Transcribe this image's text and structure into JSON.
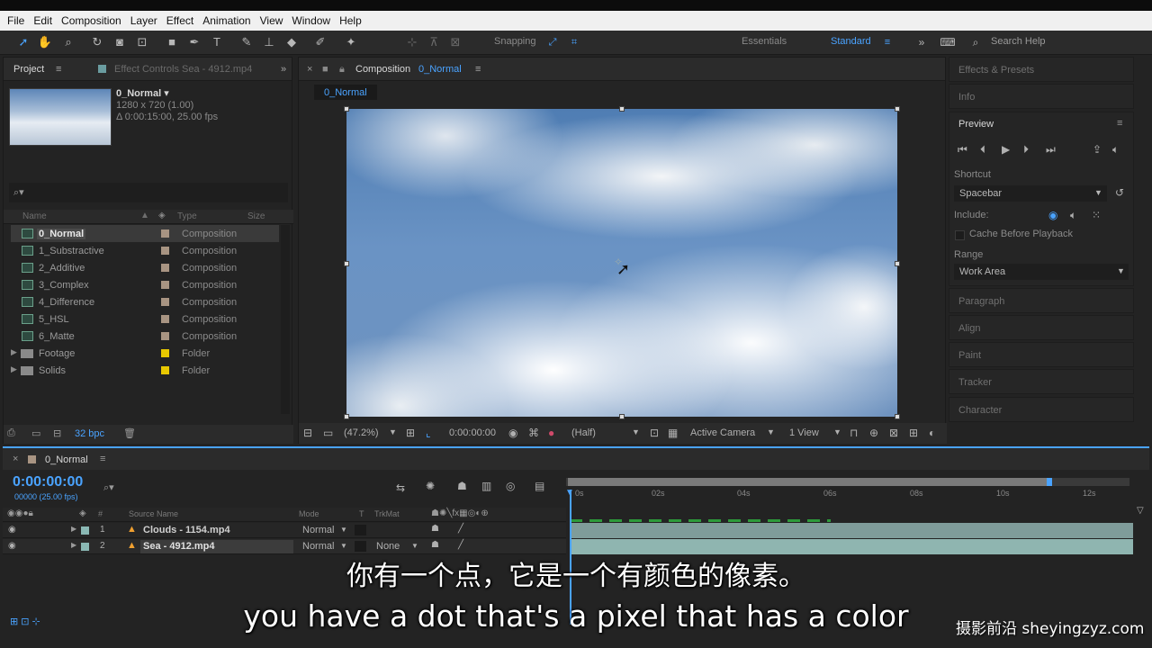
{
  "menu": [
    "File",
    "Edit",
    "Composition",
    "Layer",
    "Effect",
    "Animation",
    "View",
    "Window",
    "Help"
  ],
  "toolbar": {
    "snapping": "Snapping",
    "essentials": "Essentials",
    "standard": "Standard",
    "search_help": "Search Help"
  },
  "project": {
    "tab_project": "Project",
    "tab_effect_controls": "Effect Controls Sea - 4912.mp4",
    "comp_name": "0_Normal ▾",
    "comp_res": "1280 x 720 (1.00)",
    "comp_dur": "Δ 0:00:15:00, 25.00 fps",
    "col_name": "Name",
    "col_type": "Type",
    "col_size": "Size",
    "items": [
      {
        "name": "0_Normal",
        "type": "Composition"
      },
      {
        "name": "1_Substractive",
        "type": "Composition"
      },
      {
        "name": "2_Additive",
        "type": "Composition"
      },
      {
        "name": "3_Complex",
        "type": "Composition"
      },
      {
        "name": "4_Difference",
        "type": "Composition"
      },
      {
        "name": "5_HSL",
        "type": "Composition"
      },
      {
        "name": "6_Matte",
        "type": "Composition"
      },
      {
        "name": "Footage",
        "type": "Folder"
      },
      {
        "name": "Solids",
        "type": "Folder"
      }
    ],
    "bpc": "32 bpc"
  },
  "composition": {
    "tab_label": "Composition",
    "tab_name": "0_Normal",
    "subtab": "0_Normal",
    "zoom": "(47.2%)",
    "timecode": "0:00:00:00",
    "quality": "(Half)",
    "camera": "Active Camera",
    "views": "1 View"
  },
  "right": {
    "effects_presets": "Effects & Presets",
    "info": "Info",
    "preview": "Preview",
    "shortcut_label": "Shortcut",
    "shortcut_value": "Spacebar",
    "include_label": "Include:",
    "cache": "Cache Before Playback",
    "range_label": "Range",
    "range_value": "Work Area",
    "paragraph": "Paragraph",
    "align": "Align",
    "paint": "Paint",
    "tracker": "Tracker",
    "character": "Character"
  },
  "timeline": {
    "tab_name": "0_Normal",
    "timecode": "0:00:00:00",
    "frames": "00000 (25.00 fps)",
    "col_source": "Source Name",
    "col_mode": "Mode",
    "col_t": "T",
    "col_trkmat": "TrkMat",
    "ruler": [
      "0s",
      "02s",
      "04s",
      "06s",
      "08s",
      "10s",
      "12s"
    ],
    "layers": [
      {
        "num": "1",
        "name": "Clouds - 1154.mp4",
        "mode": "Normal",
        "trkmat": ""
      },
      {
        "num": "2",
        "name": "Sea - 4912.mp4",
        "mode": "Normal",
        "trkmat": "None"
      }
    ]
  },
  "subtitles": {
    "zh": "你有一个点，它是一个有颜色的像素。",
    "en": "you have a dot that's a pixel that has a color"
  },
  "watermark": "摄影前沿 sheyingzyz.com"
}
